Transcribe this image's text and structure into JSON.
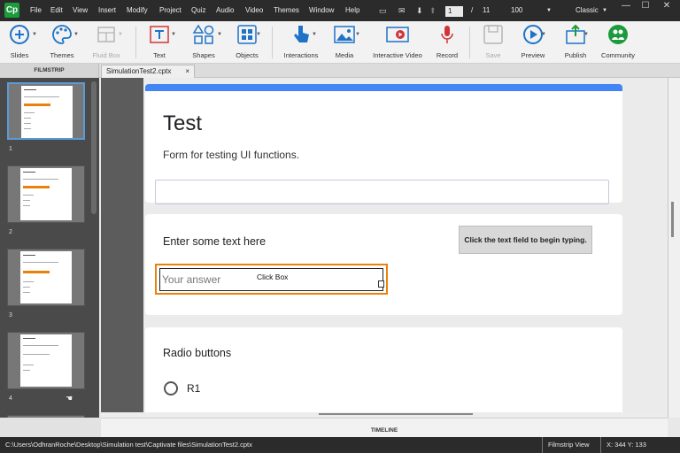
{
  "app": {
    "logo": "Cp"
  },
  "menu": [
    "File",
    "Edit",
    "View",
    "Insert",
    "Modify",
    "Project",
    "Quiz",
    "Audio",
    "Video",
    "Themes",
    "Window",
    "Help"
  ],
  "slide_nav": {
    "current": "1",
    "separator": "/",
    "total": "11",
    "zoom": "100"
  },
  "workspace": {
    "mode": "Classic"
  },
  "toolbar": {
    "slides": "Slides",
    "themes": "Themes",
    "fluid_box": "Fluid Box",
    "text": "Text",
    "shapes": "Shapes",
    "objects": "Objects",
    "interactions": "Interactions",
    "media": "Media",
    "interactive_video": "Interactive Video",
    "record": "Record",
    "save": "Save",
    "preview": "Preview",
    "publish": "Publish",
    "community": "Community"
  },
  "filmstrip": {
    "header": "FILMSTRIP",
    "slides": [
      "1",
      "2",
      "3",
      "4"
    ]
  },
  "tab": {
    "name": "SimulationTest2.cptx",
    "close": "×"
  },
  "form": {
    "title": "Test",
    "description": "Form for testing UI functions.",
    "question1": "Enter some text here",
    "hint_caption": "Click the text field to begin typing.",
    "answer_placeholder": "Your answer",
    "click_box_label": "Click Box",
    "question2": "Radio buttons",
    "radio_options": [
      "R1"
    ]
  },
  "timeline": {
    "label": "TIMELINE"
  },
  "status": {
    "path": "C:\\Users\\OdhranRoche\\Desktop\\Simulation test\\Captivate files\\SimulationTest2.cptx",
    "view": "Filmstrip View",
    "coords": "X: 344 Y: 133"
  },
  "colors": {
    "accent": "#4285f4",
    "highlight": "#e8820c",
    "logo_green": "#1d9a3c"
  }
}
